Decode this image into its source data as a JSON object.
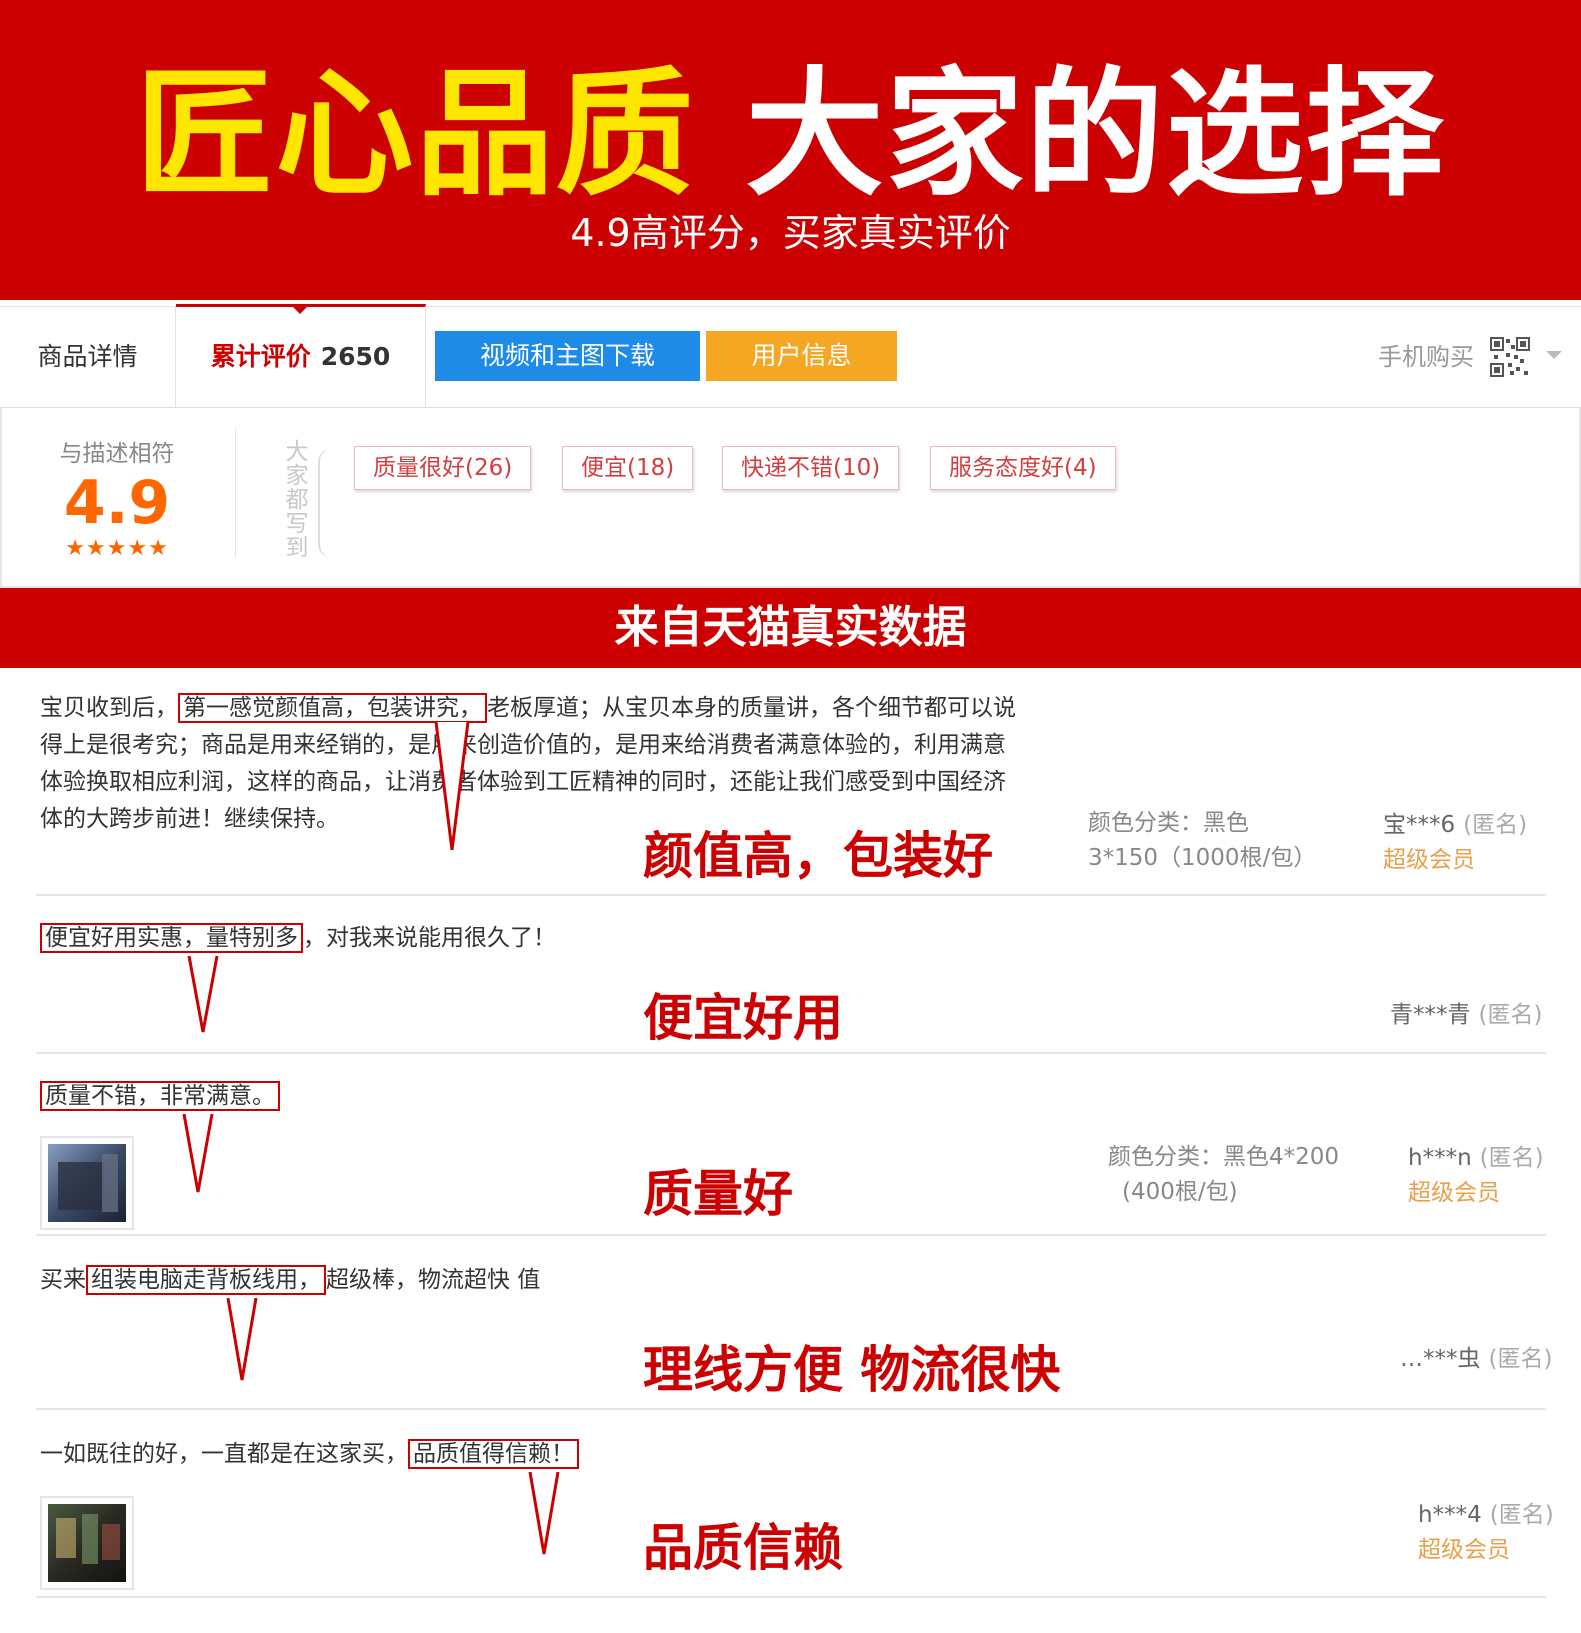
{
  "banner": {
    "title_yellow": "匠心品质",
    "title_white": "大家的选择",
    "subtitle": "4.9高评分，买家真实评价",
    "bg_color": "#cc0000"
  },
  "tabs": {
    "detail": "商品详情",
    "reviews": "累计评价",
    "reviews_count": "2650",
    "video_button": "视频和主图下载",
    "user_button": "用户信息",
    "mobile_buy": "手机购买",
    "video_color": "#1e8ce6",
    "user_color": "#f5a623"
  },
  "rating": {
    "label": "与描述相符",
    "score": "4.9",
    "stars": "★★★★★",
    "vertical_label": "大家都写到",
    "tags": [
      "质量很好(26)",
      "便宜(18)",
      "快递不错(10)",
      "服务态度好(4)"
    ]
  },
  "strip_title": "来自天猫真实数据",
  "reviews": [
    {
      "pre": "宝贝收到后，",
      "highlight": "第一感觉颜值高，包装讲究，",
      "post": "老板厚道；从宝贝本身的质量讲，各个细节都可以说得上是很考究；商品是用来经销的，是用来创造价值的，是用来给消费者满意体验的，利用满意体验换取相应利润，这样的商品，让消费者体验到工匠精神的同时，还能让我们感受到中国经济体的大跨步前进！继续保持。",
      "callout": "颜值高，包装好",
      "meta_line1": "颜色分类：黑色",
      "meta_line2": "3*150（1000根/包）",
      "user": "宝***6",
      "anon": "(匿名)",
      "vip": "超级会员"
    },
    {
      "pre": "",
      "highlight": "便宜好用实惠，量特别多",
      "post": "，对我来说能用很久了！",
      "callout": "便宜好用",
      "user": "青***青",
      "anon": "(匿名)"
    },
    {
      "pre": "",
      "highlight": "质量不错，非常满意。",
      "post": "",
      "callout": "质量好",
      "meta_line1": "颜色分类：黑色4*200",
      "meta_line2": "(400根/包)",
      "user": "h***n",
      "anon": "(匿名)",
      "vip": "超级会员"
    },
    {
      "pre": "买来",
      "highlight": "组装电脑走背板线用，",
      "post": "超级棒，物流超快 值",
      "callout": "理线方便 物流很快",
      "user": "…***虫",
      "anon": "(匿名)"
    },
    {
      "pre": "一如既往的好，一直都是在这家买，",
      "highlight": "品质值得信赖！",
      "post": "",
      "callout": "品质信赖",
      "user": "h***4",
      "anon": "(匿名)",
      "vip": "超级会员"
    }
  ]
}
